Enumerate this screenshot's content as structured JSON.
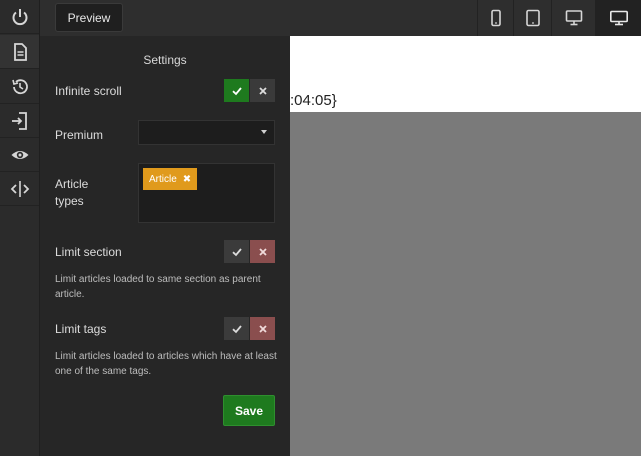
{
  "toolbar": {
    "preview_label": "Preview",
    "devices": [
      "mobile-icon",
      "tablet-icon",
      "desktop-icon",
      "widescreen-icon"
    ],
    "active_device": "widescreen-icon"
  },
  "rail": {
    "items": [
      "power-icon",
      "document-icon",
      "history-icon",
      "import-icon",
      "eye-icon",
      "code-split-icon"
    ],
    "active_item": "document-icon"
  },
  "canvas": {
    "text": ":04:05}"
  },
  "settings": {
    "title": "Settings",
    "infinite_scroll": {
      "label": "Infinite scroll",
      "value": true
    },
    "premium": {
      "label": "Premium",
      "value": ""
    },
    "article_types": {
      "label_line1": "Article",
      "label_line2": "types",
      "tags": [
        "Article"
      ]
    },
    "limit_section": {
      "label": "Limit section",
      "value": false,
      "description": "Limit articles loaded to same section as parent article."
    },
    "limit_tags": {
      "label": "Limit tags",
      "value": false,
      "description": "Limit articles loaded to articles which have at least one of the same tags."
    },
    "save_label": "Save"
  },
  "colors": {
    "accent_green": "#1e7a1e",
    "tag_orange": "#e09a1c",
    "off_red": "#8a4e4e"
  }
}
